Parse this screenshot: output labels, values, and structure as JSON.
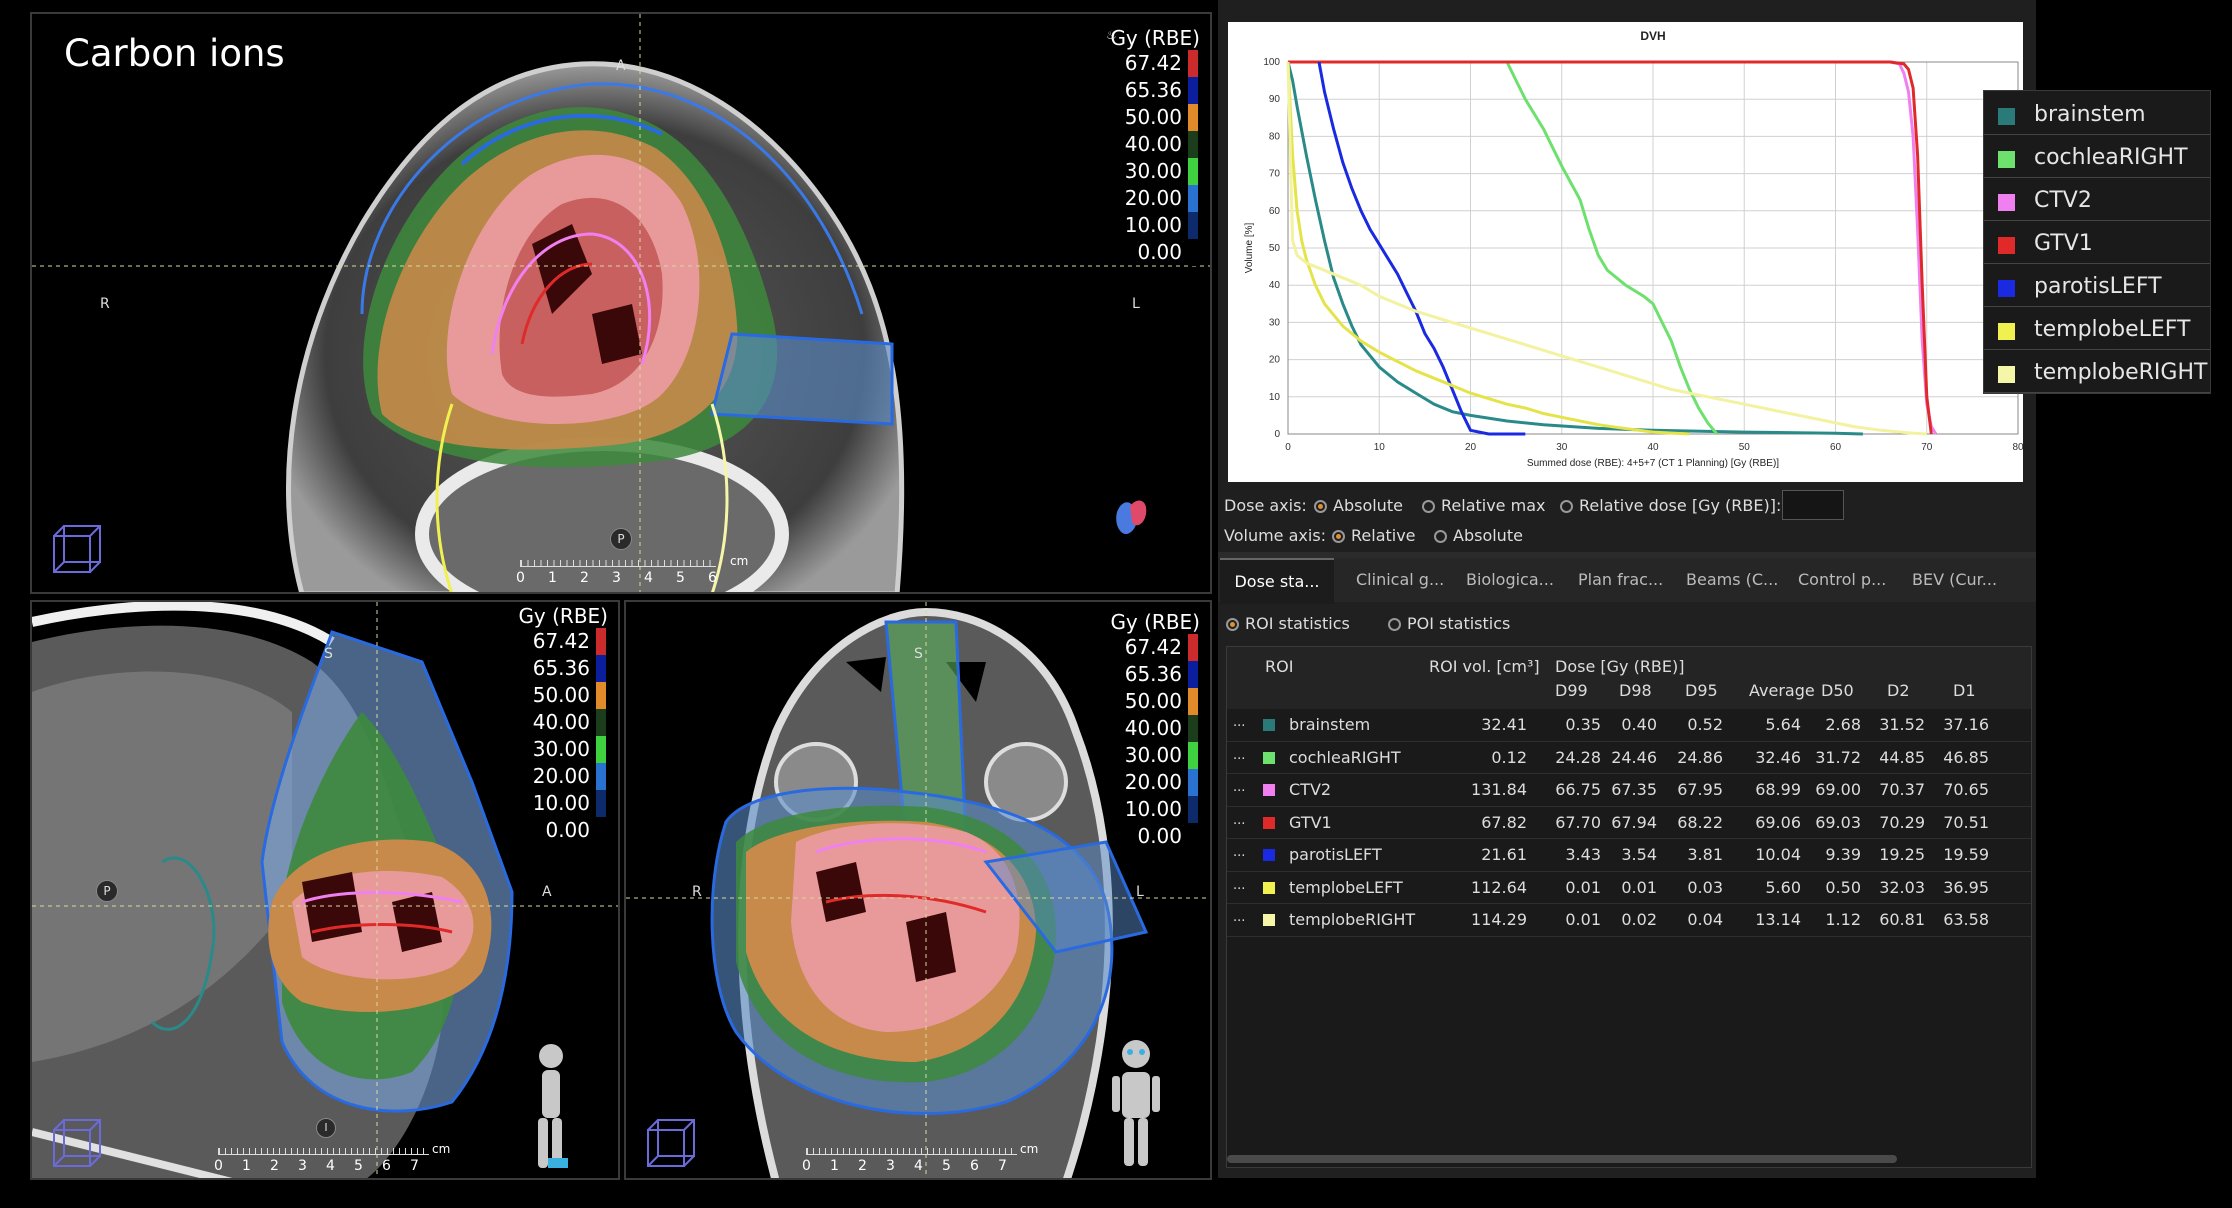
{
  "title": "Carbon ions",
  "dose_scale": {
    "unit": "Gy (RBE)",
    "values": [
      "67.42",
      "65.36",
      "50.00",
      "40.00",
      "30.00",
      "20.00",
      "10.00",
      "0.00"
    ],
    "colors": [
      "#cc2b2b",
      "#0a1e9e",
      "#e08a2a",
      "#1b3d1b",
      "#3fd13f",
      "#2a72cf",
      "#0d2a6a",
      "#000000"
    ]
  },
  "views": {
    "axial": {
      "top": "A",
      "left": "R",
      "right": "L",
      "bottom": "P",
      "ruler_ticks": [
        "0",
        "1",
        "2",
        "3",
        "4",
        "5",
        "6"
      ],
      "ruler_unit": "cm"
    },
    "sagittal": {
      "top": "S",
      "left": "P",
      "right": "A",
      "bottom": "I",
      "ruler_ticks": [
        "0",
        "1",
        "2",
        "3",
        "4",
        "5",
        "6",
        "7"
      ],
      "ruler_unit": "cm"
    },
    "coronal": {
      "top": "S",
      "left": "R",
      "right": "L",
      "ruler_ticks": [
        "0",
        "1",
        "2",
        "3",
        "4",
        "5",
        "6",
        "7"
      ],
      "ruler_unit": "cm"
    }
  },
  "chart_data": {
    "type": "line",
    "title": "DVH",
    "xlabel": "Summed dose (RBE): 4+5+7 (CT 1 Planning) [Gy (RBE)]",
    "ylabel": "Volume [%]",
    "xlim": [
      0,
      80
    ],
    "ylim": [
      0,
      100
    ],
    "xticks": [
      0,
      10,
      20,
      30,
      40,
      50,
      60,
      70,
      80
    ],
    "yticks": [
      0,
      10,
      20,
      30,
      40,
      50,
      60,
      70,
      80,
      90,
      100
    ],
    "grid": true,
    "series": [
      {
        "name": "brainstem",
        "color": "#2a8a8a",
        "x": [
          0,
          0.5,
          1,
          2,
          3,
          4,
          5,
          6,
          7,
          8,
          10,
          12,
          14,
          16,
          18,
          20,
          24,
          28,
          34,
          40,
          50,
          60,
          63
        ],
        "y": [
          100,
          95,
          88,
          75,
          63,
          52,
          42,
          35,
          29,
          24,
          18,
          14,
          11,
          8,
          6,
          5,
          3.5,
          2.5,
          1.5,
          1,
          0.5,
          0.2,
          0
        ]
      },
      {
        "name": "cochleaRIGHT",
        "color": "#6ee06e",
        "x": [
          24,
          25,
          26,
          28,
          30,
          32,
          33,
          34,
          35,
          37,
          39,
          40,
          41,
          42,
          43,
          44,
          45,
          46,
          47
        ],
        "y": [
          100,
          95,
          90,
          82,
          72,
          63,
          55,
          48,
          44,
          40,
          37,
          35,
          30,
          25,
          18,
          12,
          7,
          3,
          0
        ]
      },
      {
        "name": "CTV2",
        "color": "#f080f0",
        "x": [
          0,
          60,
          66,
          67,
          67.5,
          68,
          68.5,
          69,
          69.5,
          70,
          70.5,
          71
        ],
        "y": [
          100,
          100,
          100,
          99.5,
          97,
          92,
          80,
          55,
          25,
          8,
          2,
          0
        ]
      },
      {
        "name": "GTV1",
        "color": "#e02a2a",
        "x": [
          0,
          66,
          67.5,
          68,
          68.5,
          69,
          69.5,
          70,
          70.5
        ],
        "y": [
          100,
          100,
          99.5,
          98,
          93,
          75,
          40,
          10,
          0
        ]
      },
      {
        "name": "parotisLEFT",
        "color": "#1a2ae0",
        "x": [
          3.4,
          4,
          5,
          6,
          7,
          8,
          9,
          10,
          11,
          12,
          13,
          14,
          15,
          16,
          17,
          18,
          19,
          20,
          22,
          26
        ],
        "y": [
          100,
          92,
          82,
          73,
          66,
          60,
          55,
          51,
          47,
          43,
          38,
          33,
          27,
          23,
          18,
          12,
          6,
          1,
          0,
          0
        ]
      },
      {
        "name": "templobeLEFT",
        "color": "#e4e44a",
        "x": [
          0,
          0.5,
          1,
          1.5,
          2,
          3,
          4,
          6,
          8,
          10,
          12,
          14,
          16,
          18,
          20,
          22,
          24,
          26,
          28,
          30,
          32,
          34,
          36,
          40,
          44
        ],
        "y": [
          100,
          75,
          60,
          52,
          47,
          40,
          35,
          29,
          25,
          22,
          19.5,
          17,
          15,
          13,
          11,
          9.5,
          8,
          7,
          5.5,
          4.5,
          3.5,
          2.5,
          1.8,
          0.5,
          0
        ]
      },
      {
        "name": "templobeRIGHT",
        "color": "#f2f2a0",
        "x": [
          0,
          0.5,
          1,
          2,
          4,
          6,
          8,
          10,
          14,
          18,
          22,
          26,
          30,
          34,
          38,
          42,
          46,
          50,
          54,
          58,
          62,
          65,
          68,
          70
        ],
        "y": [
          100,
          52,
          48,
          46,
          44,
          42,
          40,
          37,
          33,
          30,
          27,
          24,
          21,
          18,
          15,
          12,
          10,
          8,
          6,
          4,
          2,
          1,
          0.3,
          0
        ]
      }
    ]
  },
  "legend": {
    "items": [
      {
        "label": "brainstem",
        "color": "#2a7a7a"
      },
      {
        "label": "cochleaRIGHT",
        "color": "#6ee06e"
      },
      {
        "label": "CTV2",
        "color": "#f080f0"
      },
      {
        "label": "GTV1",
        "color": "#e02a2a"
      },
      {
        "label": "parotisLEFT",
        "color": "#1a2ae0"
      },
      {
        "label": "templobeLEFT",
        "color": "#f0f050"
      },
      {
        "label": "templobeRIGHT",
        "color": "#f6f6a8"
      }
    ]
  },
  "dvh_controls": {
    "dose_axis_label": "Dose axis:",
    "dose_options": [
      "Absolute",
      "Relative max",
      "Relative dose [Gy (RBE)]:"
    ],
    "dose_selected": 0,
    "volume_axis_label": "Volume axis:",
    "volume_options": [
      "Relative",
      "Absolute"
    ],
    "volume_selected": 0
  },
  "tabs": [
    "Dose sta...",
    "Clinical g...",
    "Biologica...",
    "Plan frac...",
    "Beams (C...",
    "Control p...",
    "BEV (Cur..."
  ],
  "active_tab": 0,
  "stats_mode": {
    "options": [
      "ROI statistics",
      "POI statistics"
    ],
    "selected": 0
  },
  "table": {
    "headers": {
      "roi": "ROI",
      "vol": "ROI vol. [cm³]",
      "dose_group": "Dose [Gy (RBE)]",
      "cols": [
        "D99",
        "D98",
        "D95",
        "Average",
        "D50",
        "D2",
        "D1"
      ]
    },
    "rows": [
      {
        "name": "brainstem",
        "color": "#2a7a7a",
        "vol": "32.41",
        "vals": [
          "0.35",
          "0.40",
          "0.52",
          "5.64",
          "2.68",
          "31.52",
          "37.16"
        ]
      },
      {
        "name": "cochleaRIGHT",
        "color": "#6ee06e",
        "vol": "0.12",
        "vals": [
          "24.28",
          "24.46",
          "24.86",
          "32.46",
          "31.72",
          "44.85",
          "46.85"
        ]
      },
      {
        "name": "CTV2",
        "color": "#f080f0",
        "vol": "131.84",
        "vals": [
          "66.75",
          "67.35",
          "67.95",
          "68.99",
          "69.00",
          "70.37",
          "70.65"
        ]
      },
      {
        "name": "GTV1",
        "color": "#e02a2a",
        "vol": "67.82",
        "vals": [
          "67.70",
          "67.94",
          "68.22",
          "69.06",
          "69.03",
          "70.29",
          "70.51"
        ]
      },
      {
        "name": "parotisLEFT",
        "color": "#1a2ae0",
        "vol": "21.61",
        "vals": [
          "3.43",
          "3.54",
          "3.81",
          "10.04",
          "9.39",
          "19.25",
          "19.59"
        ]
      },
      {
        "name": "templobeLEFT",
        "color": "#f0f050",
        "vol": "112.64",
        "vals": [
          "0.01",
          "0.01",
          "0.03",
          "5.60",
          "0.50",
          "32.03",
          "36.95"
        ]
      },
      {
        "name": "templobeRIGHT",
        "color": "#f6f6a8",
        "vol": "114.29",
        "vals": [
          "0.01",
          "0.02",
          "0.04",
          "13.14",
          "1.12",
          "60.81",
          "63.58"
        ]
      }
    ],
    "row_menu": "..."
  }
}
